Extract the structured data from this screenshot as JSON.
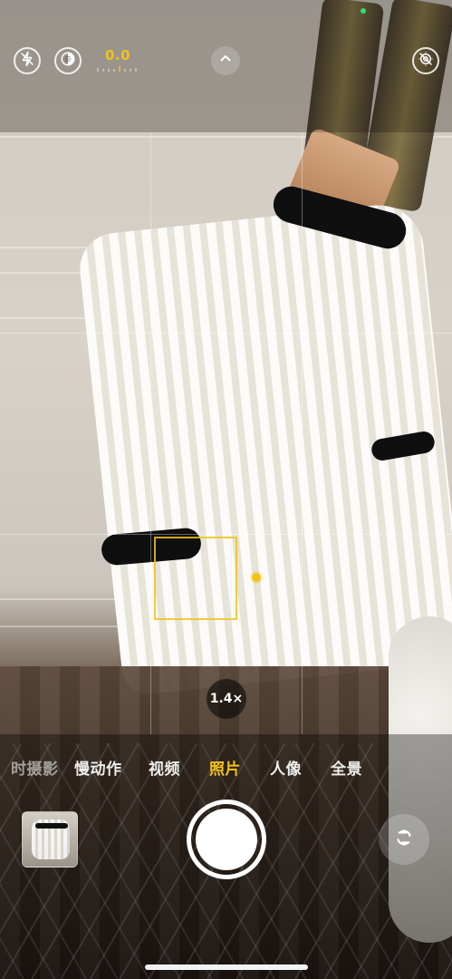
{
  "top_controls": {
    "flash_icon": "flash-off-icon",
    "live_icon": "live-photo-icon",
    "exposure_value": "0.0",
    "expand_icon": "chevron-up-icon",
    "live_off_icon": "live-off-icon"
  },
  "viewfinder": {
    "zoom_label": "1.4×"
  },
  "modes": [
    {
      "label": "时摄影"
    },
    {
      "label": "慢动作"
    },
    {
      "label": "视频"
    },
    {
      "label": "照片"
    },
    {
      "label": "人像"
    },
    {
      "label": "全景"
    }
  ],
  "bottom_controls": {
    "thumbnail_icon": "photo-thumbnail",
    "shutter_icon": "shutter-button",
    "switch_camera_icon": "switch-camera-icon"
  },
  "colors": {
    "accent_yellow": "#f3c21a",
    "status_green": "#2ee06b",
    "white": "#ffffff"
  }
}
